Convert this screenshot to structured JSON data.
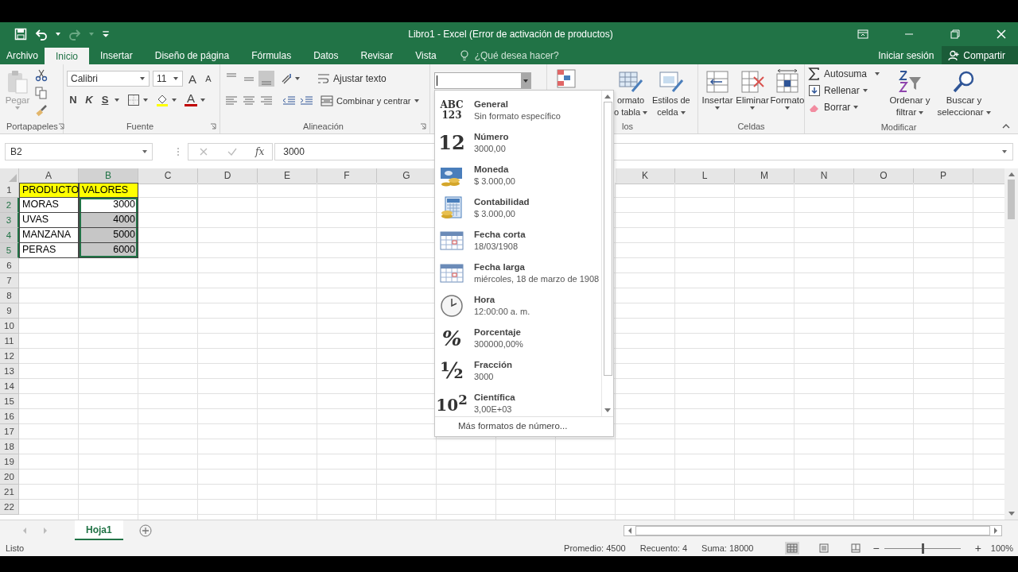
{
  "window": {
    "title": "Libro1 - Excel (Error de activación de productos)"
  },
  "tabs": [
    {
      "label": "Archivo",
      "selected": false
    },
    {
      "label": "Inicio",
      "selected": true
    },
    {
      "label": "Insertar",
      "selected": false
    },
    {
      "label": "Diseño de página",
      "selected": false
    },
    {
      "label": "Fórmulas",
      "selected": false
    },
    {
      "label": "Datos",
      "selected": false
    },
    {
      "label": "Revisar",
      "selected": false
    },
    {
      "label": "Vista",
      "selected": false
    }
  ],
  "tell_me": {
    "placeholder": "¿Qué desea hacer?"
  },
  "account": {
    "sign_in": "Iniciar sesión",
    "share": "Compartir"
  },
  "ribbon": {
    "clipboard": {
      "paste": "Pegar",
      "label": "Portapapeles"
    },
    "font": {
      "family": "Calibri",
      "size": "11",
      "grow": "A",
      "shrink": "A",
      "bold": "N",
      "italic": "K",
      "underline": "S",
      "color_letter": "A",
      "label": "Fuente"
    },
    "alignment": {
      "vertical": [
        {
          "selected": false
        },
        {
          "selected": false
        },
        {
          "selected": true
        }
      ],
      "wrap": "Ajustar texto",
      "merge": "Combinar y centrar",
      "label": "Alineación"
    },
    "styles": {
      "format_table": [
        "ormato",
        "o tabla"
      ],
      "cell_styles": [
        "Estilos de",
        "celda"
      ],
      "label": "los"
    },
    "cells": {
      "buttons": [
        {
          "label": "Insertar",
          "kind": "insert"
        },
        {
          "label": "Eliminar",
          "kind": "delete"
        },
        {
          "label": "Formato",
          "kind": "format"
        }
      ],
      "label": "Celdas"
    },
    "editing": {
      "autosum": "Autosuma",
      "fill": "Rellenar",
      "clear": "Borrar",
      "sort": [
        "Ordenar y",
        "filtrar"
      ],
      "find": [
        "Buscar y",
        "seleccionar"
      ],
      "label": "Modificar"
    }
  },
  "formula_bar": {
    "name_box": "B2",
    "function_label": "fx",
    "value": "3000"
  },
  "columns_left": [
    {
      "label": "A",
      "selected": false
    },
    {
      "label": "B",
      "selected": true
    },
    {
      "label": "C",
      "selected": false
    },
    {
      "label": "D",
      "selected": false
    },
    {
      "label": "E",
      "selected": false
    },
    {
      "label": "F",
      "selected": false
    },
    {
      "label": "G",
      "selected": false
    }
  ],
  "columns_right": [
    {
      "label": "K",
      "selected": false
    },
    {
      "label": "L",
      "selected": false
    },
    {
      "label": "M",
      "selected": false
    },
    {
      "label": "N",
      "selected": false
    },
    {
      "label": "O",
      "selected": false
    },
    {
      "label": "P",
      "selected": false
    }
  ],
  "rows": [
    {
      "number": "1",
      "selected": false,
      "product": "PRODUCTO",
      "value": "VALORES",
      "kind": "header"
    },
    {
      "number": "2",
      "selected": true,
      "product": "MORAS",
      "value": "3000",
      "kind": "active"
    },
    {
      "number": "3",
      "selected": true,
      "product": "UVAS",
      "value": "4000",
      "kind": "selected"
    },
    {
      "number": "4",
      "selected": true,
      "product": "MANZANA",
      "value": "5000",
      "kind": "selected"
    },
    {
      "number": "5",
      "selected": true,
      "product": "PERAS",
      "value": "6000",
      "kind": "selected"
    },
    {
      "number": "6",
      "selected": false
    },
    {
      "number": "7",
      "selected": false
    },
    {
      "number": "8",
      "selected": false
    },
    {
      "number": "9",
      "selected": false
    },
    {
      "number": "10",
      "selected": false
    },
    {
      "number": "11",
      "selected": false
    },
    {
      "number": "12",
      "selected": false
    },
    {
      "number": "13",
      "selected": false
    },
    {
      "number": "14",
      "selected": false
    },
    {
      "number": "15",
      "selected": false
    },
    {
      "number": "16",
      "selected": false
    },
    {
      "number": "17",
      "selected": false
    },
    {
      "number": "18",
      "selected": false
    },
    {
      "number": "19",
      "selected": false
    },
    {
      "number": "20",
      "selected": false
    },
    {
      "number": "21",
      "selected": false
    },
    {
      "number": "22",
      "selected": false
    }
  ],
  "number_format_menu": {
    "items": [
      {
        "kind": "general",
        "glyph": "ABC 123",
        "name": "General",
        "example": "Sin formato específico"
      },
      {
        "kind": "number",
        "glyph": "12",
        "name": "Número",
        "example": "3000,00"
      },
      {
        "kind": "currency",
        "name": "Moneda",
        "example": "$ 3.000,00"
      },
      {
        "kind": "accounting",
        "name": "Contabilidad",
        "example": "$ 3.000,00"
      },
      {
        "kind": "short_date",
        "name": "Fecha corta",
        "example": "18/03/1908"
      },
      {
        "kind": "long_date",
        "name": "Fecha larga",
        "example": "miércoles, 18 de marzo de 1908"
      },
      {
        "kind": "time",
        "name": "Hora",
        "example": "12:00:00 a. m."
      },
      {
        "kind": "percent",
        "glyph": "%",
        "name": "Porcentaje",
        "example": "300000,00%"
      },
      {
        "kind": "fraction",
        "glyph": "½",
        "name": "Fracción",
        "example": "3000"
      },
      {
        "kind": "scientific",
        "glyph": "10$^{2}$",
        "name": "Científica",
        "example": "3,00E+03"
      }
    ],
    "more": "Más formatos de número..."
  },
  "sheets": [
    {
      "label": "Hoja1",
      "selected": true
    }
  ],
  "status_bar": {
    "mode": "Listo",
    "average": "Promedio: 4500",
    "count": "Recuento: 4",
    "sum": "Suma: 18000",
    "zoom_out": "−",
    "zoom_in": "+",
    "zoom": "100%",
    "zoom_level": {
      "level": 0.5
    }
  }
}
